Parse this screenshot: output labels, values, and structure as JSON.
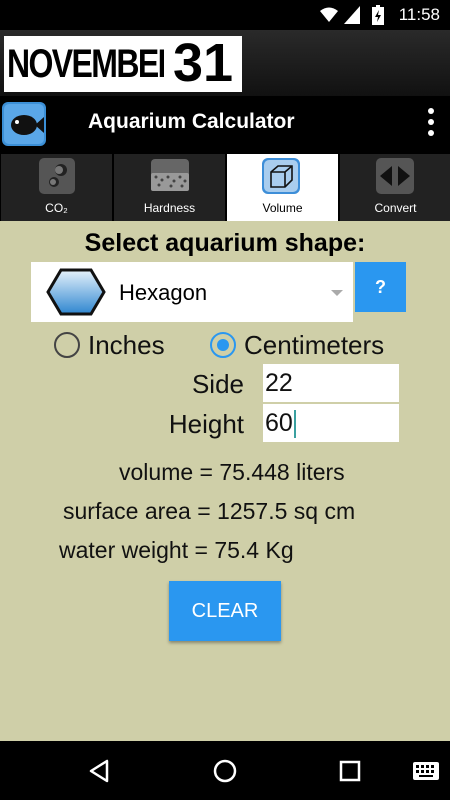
{
  "status_bar": {
    "time": "11:58"
  },
  "banner": {
    "month": "NOVEMBER",
    "day": "31"
  },
  "app": {
    "title": "Aquarium Calculator"
  },
  "tabs": [
    {
      "label": "CO₂",
      "active": false,
      "icon": "co2-bubbles-icon"
    },
    {
      "label": "Hardness",
      "active": false,
      "icon": "hardness-gravel-icon"
    },
    {
      "label": "Volume",
      "active": true,
      "icon": "volume-cube-icon"
    },
    {
      "label": "Convert",
      "active": false,
      "icon": "convert-arrows-icon"
    }
  ],
  "content": {
    "heading": "Select aquarium shape:",
    "shape": {
      "selected": "Hexagon",
      "icon": "hexagon-icon"
    },
    "help_label": "?",
    "units": {
      "inches_label": "Inches",
      "cm_label": "Centimeters",
      "selected": "Centimeters"
    },
    "fields": {
      "side": {
        "label": "Side",
        "value": "22"
      },
      "height": {
        "label": "Height",
        "value": "60"
      }
    },
    "results": {
      "volume": "volume = 75.448 liters",
      "surface_area": "surface area = 1257.5 sq cm",
      "water_weight": "water weight = 75.4 Kg"
    },
    "clear_label": "CLEAR"
  },
  "colors": {
    "accent": "#2a97f0",
    "background": "#cfcfa8",
    "bar": "#000000"
  }
}
